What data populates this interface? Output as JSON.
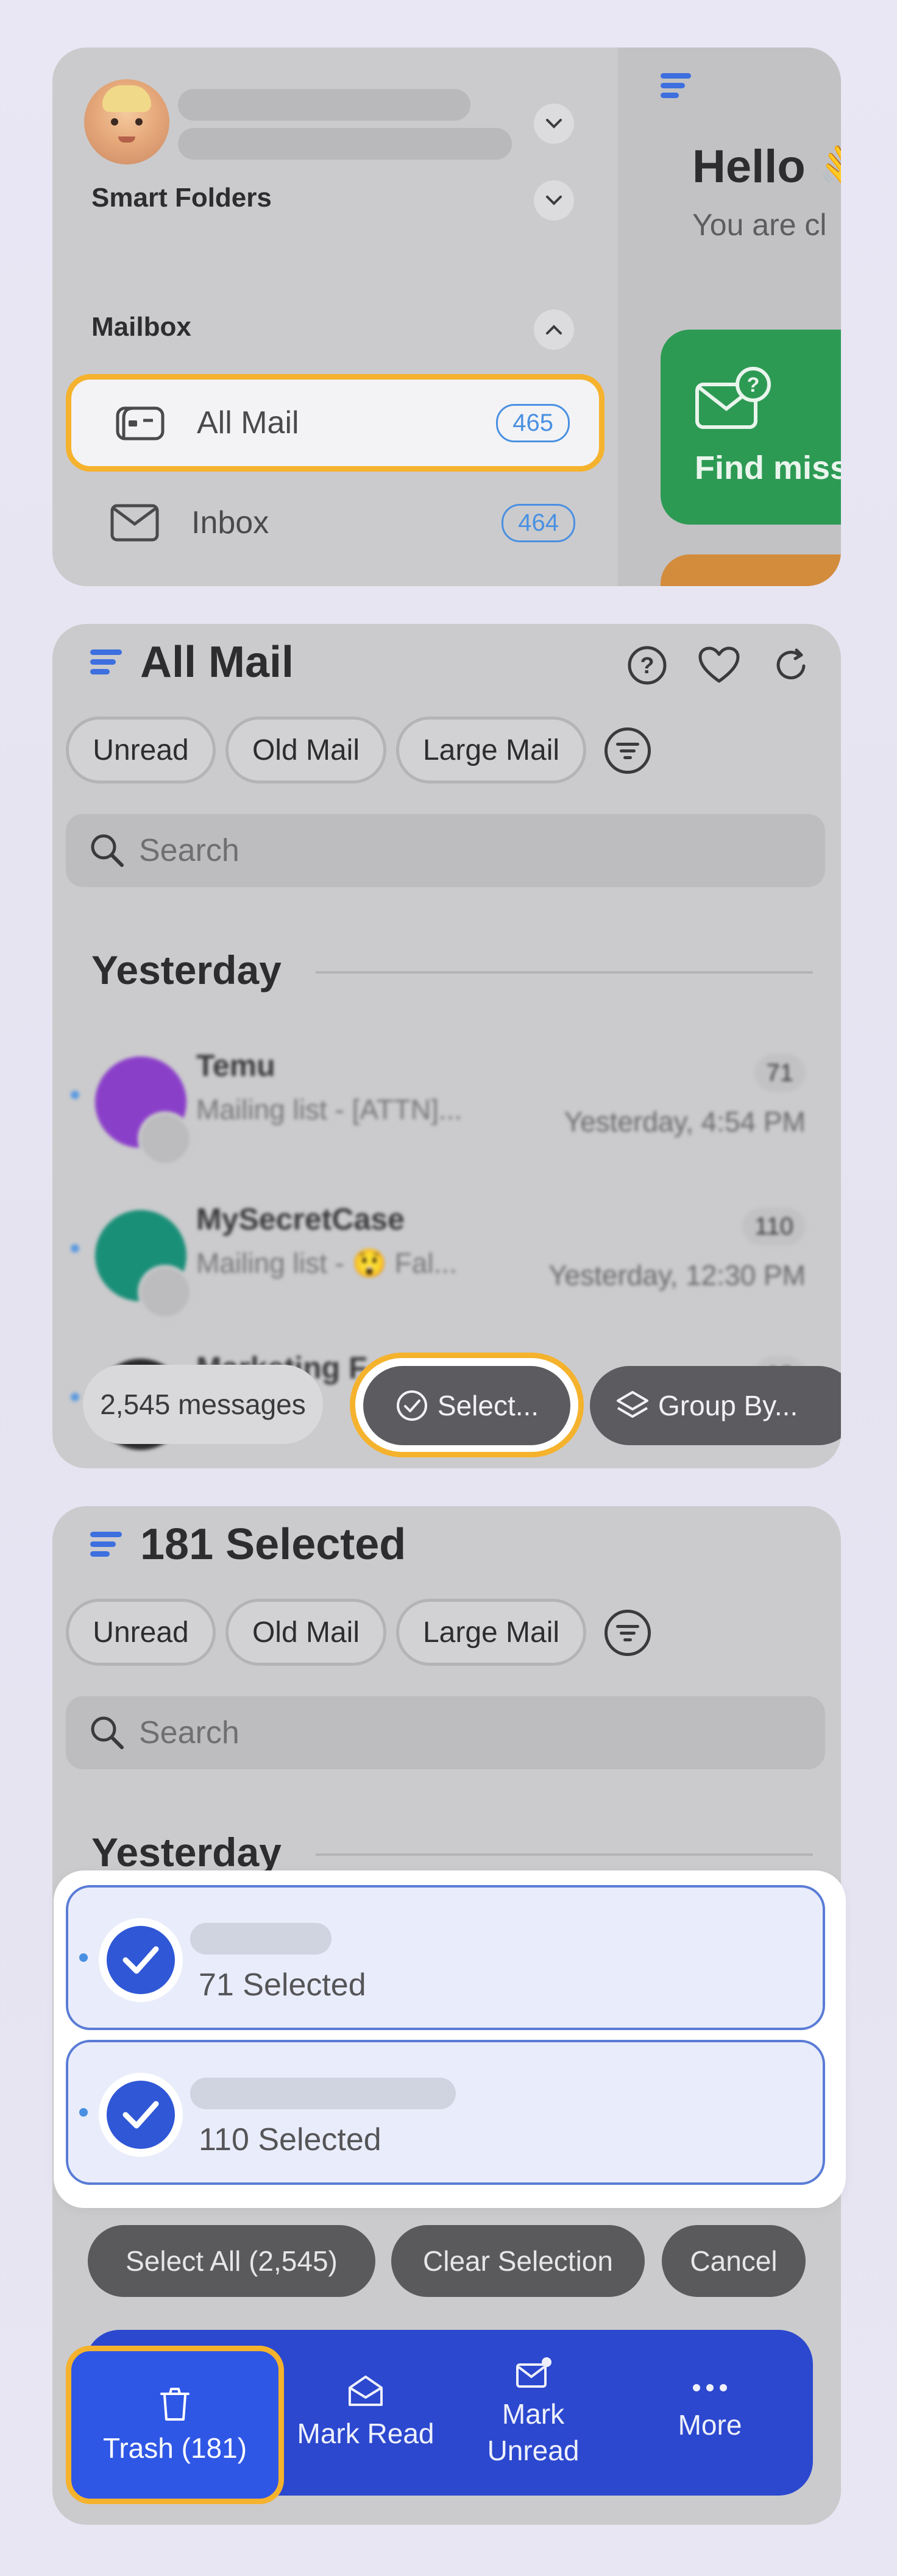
{
  "panel1": {
    "smart_folders": "Smart Folders",
    "mailbox": "Mailbox",
    "mailboxes": [
      {
        "label": "All Mail",
        "count": "465"
      },
      {
        "label": "Inbox",
        "count": "464"
      }
    ],
    "hello": "Hello 👋",
    "hello_sub": "You are cl",
    "card_label": "Find miss"
  },
  "panel2": {
    "title": "All Mail",
    "filters": [
      "Unread",
      "Old Mail",
      "Large Mail"
    ],
    "search_placeholder": "Search",
    "group": "Yesterday",
    "messages": [
      {
        "sender": "Temu",
        "snippet": "Mailing list - [ATTN]...",
        "count": "71",
        "date": "Yesterday, 4:54 PM"
      },
      {
        "sender": "MySecretCase",
        "snippet": "Mailing list - 😲 Fal...",
        "count": "110",
        "date": "Yesterday, 12:30 PM"
      },
      {
        "sender": "Marketing F...",
        "snippet": "",
        "count": "18",
        "date": ""
      }
    ],
    "message_count": "2,545 messages",
    "select_label": "Select...",
    "group_by_label": "Group By..."
  },
  "panel3": {
    "title": "181 Selected",
    "filters": [
      "Unread",
      "Old Mail",
      "Large Mail"
    ],
    "search_placeholder": "Search",
    "group": "Yesterday",
    "selections": [
      "71 Selected",
      "110 Selected"
    ],
    "actions": {
      "select_all": "Select All (2,545)",
      "clear": "Clear Selection",
      "cancel": "Cancel"
    },
    "toolbar": {
      "trash": "Trash (181)",
      "mark_read": "Mark Read",
      "mark_unread_1": "Mark",
      "mark_unread_2": "Unread",
      "more": "More"
    }
  },
  "colors": {
    "accent": "#2f57d6",
    "highlight": "#f5b22d",
    "brand_green": "#2d9a54",
    "badge_blue": "#4a90e2"
  }
}
